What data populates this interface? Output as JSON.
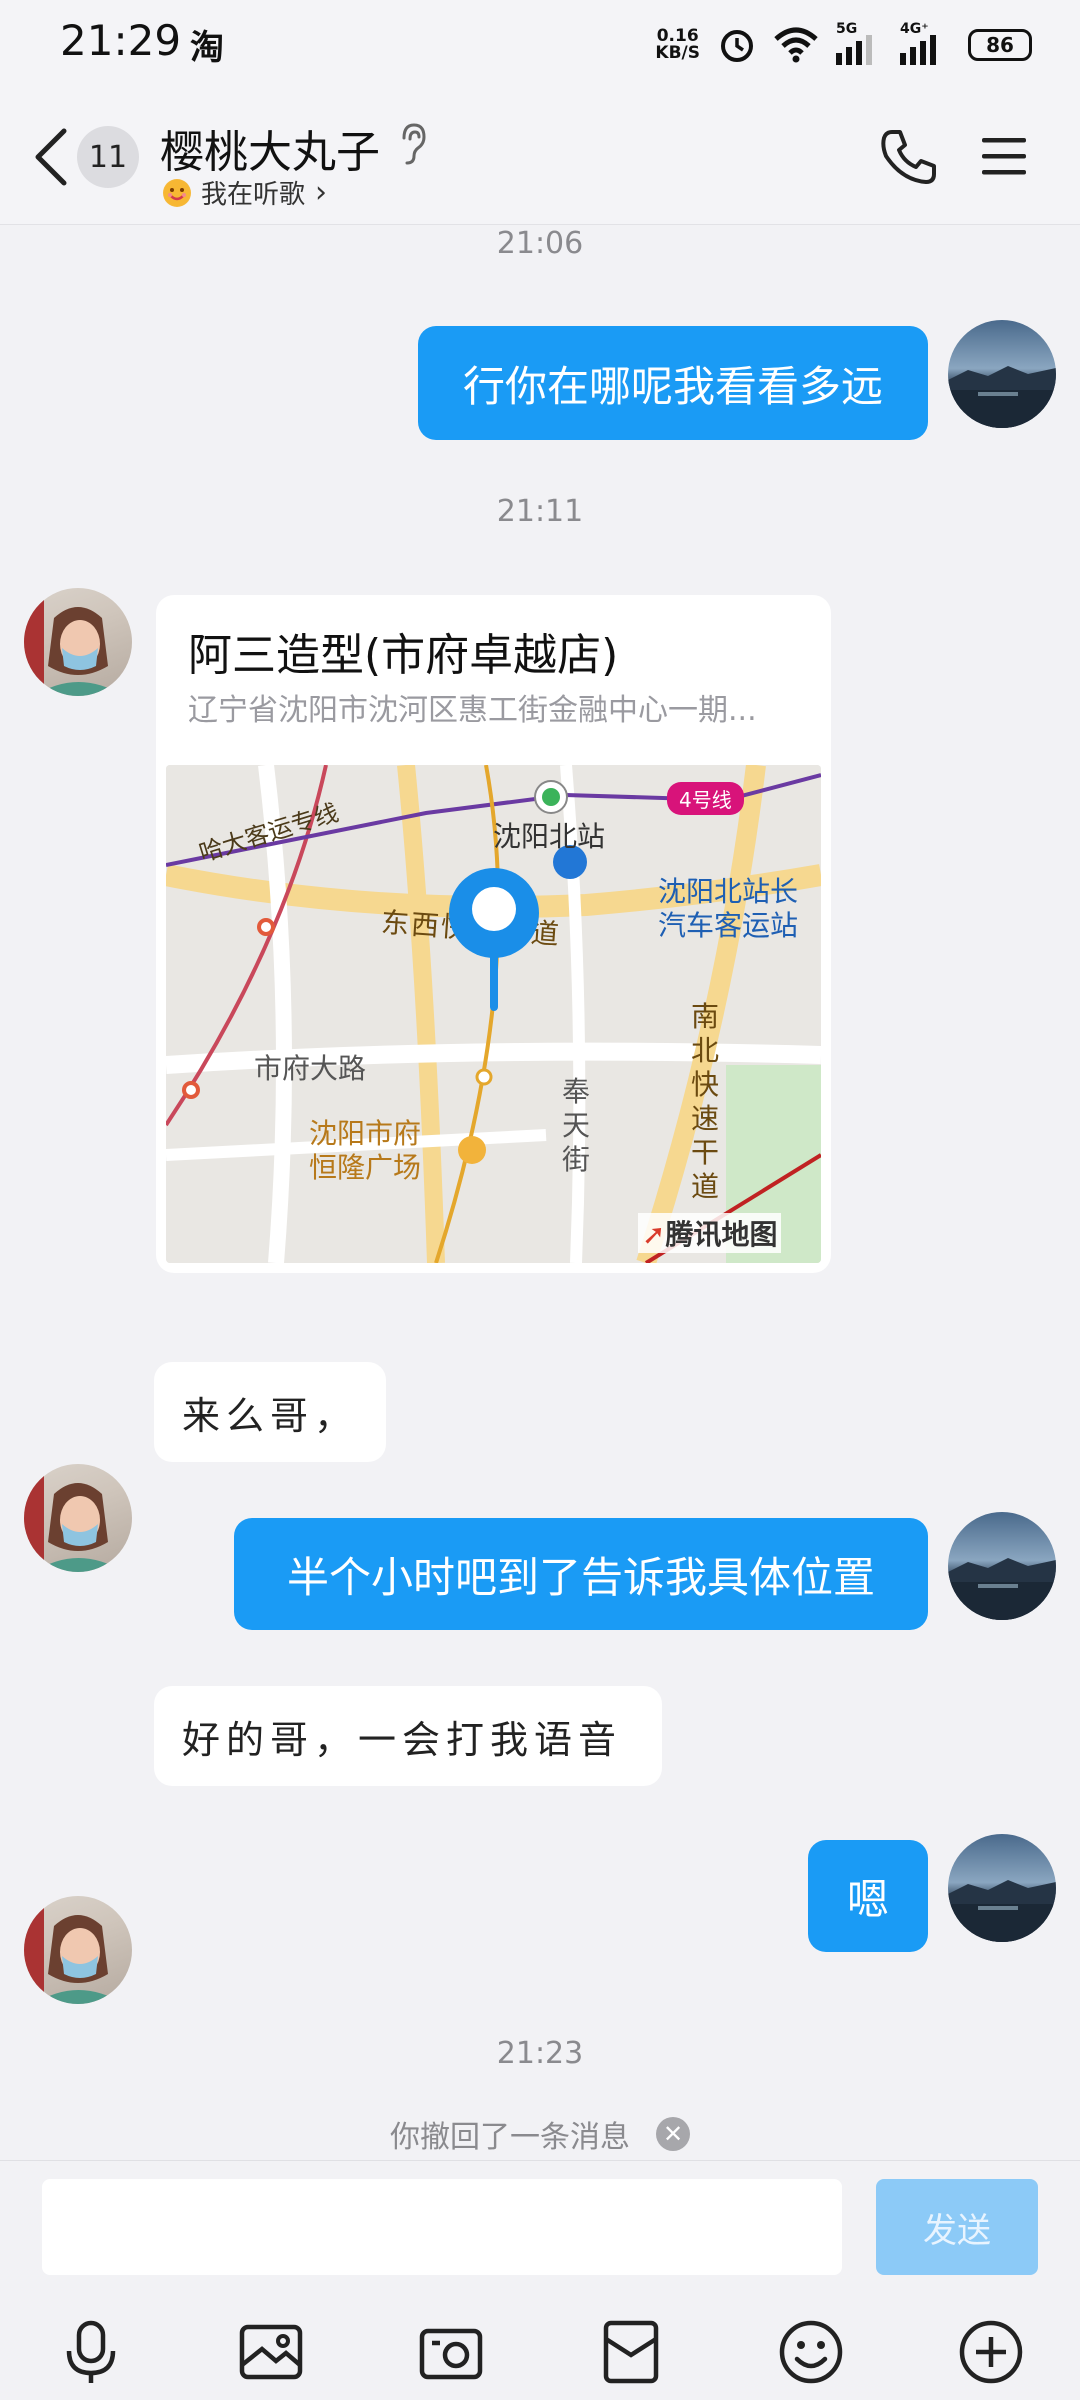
{
  "status_bar": {
    "time": "21:29",
    "app_icon": "淘",
    "net_speed_value": "0.16",
    "net_speed_unit": "KB/S",
    "sim1_label": "5G",
    "sim2_label": "4G⁺",
    "battery": "86"
  },
  "header": {
    "back_badge": "11",
    "name": "樱桃大丸子",
    "status": "我在听歌",
    "status_arrow": "›"
  },
  "messages": [
    {
      "type": "time",
      "text": "21:06"
    },
    {
      "type": "outgoing",
      "text": "行你在哪呢我看看多远"
    },
    {
      "type": "time",
      "text": "21:11"
    },
    {
      "type": "location",
      "title": "阿三造型(市府卓越店)",
      "address": "辽宁省沈阳市沈河区惠工街金融中心一期...",
      "map_labels": {
        "station": "沈阳北站",
        "line": "4号线",
        "special_line": "哈大客运专线",
        "bus_station_1": "沈阳北站长",
        "bus_station_2": "汽车客运站",
        "road_east_west": "东西快速干道",
        "road_shifu": "市府大路",
        "plaza_1": "沈阳市府",
        "plaza_2": "恒隆广场",
        "street_1": "奉",
        "street_2": "天",
        "street_3": "街",
        "highway_1": "南",
        "highway_2": "北",
        "highway_3": "快",
        "highway_4": "速",
        "highway_5": "干",
        "highway_6": "道",
        "brand": "腾讯地图"
      }
    },
    {
      "type": "incoming",
      "text": "来么哥，"
    },
    {
      "type": "outgoing",
      "text": "半个小时吧到了告诉我具体位置"
    },
    {
      "type": "incoming",
      "text": "好的哥，一会打我语音"
    },
    {
      "type": "outgoing",
      "text": "嗯"
    },
    {
      "type": "time",
      "text": "21:23"
    }
  ],
  "recall_notice": "你撤回了一条消息",
  "recall_close": "✕",
  "input": {
    "placeholder": "",
    "value": "",
    "send_label": "发送"
  },
  "toolbar": [
    "microphone-icon",
    "image-icon",
    "camera-icon",
    "red-packet-icon",
    "emoji-icon",
    "plus-icon"
  ]
}
